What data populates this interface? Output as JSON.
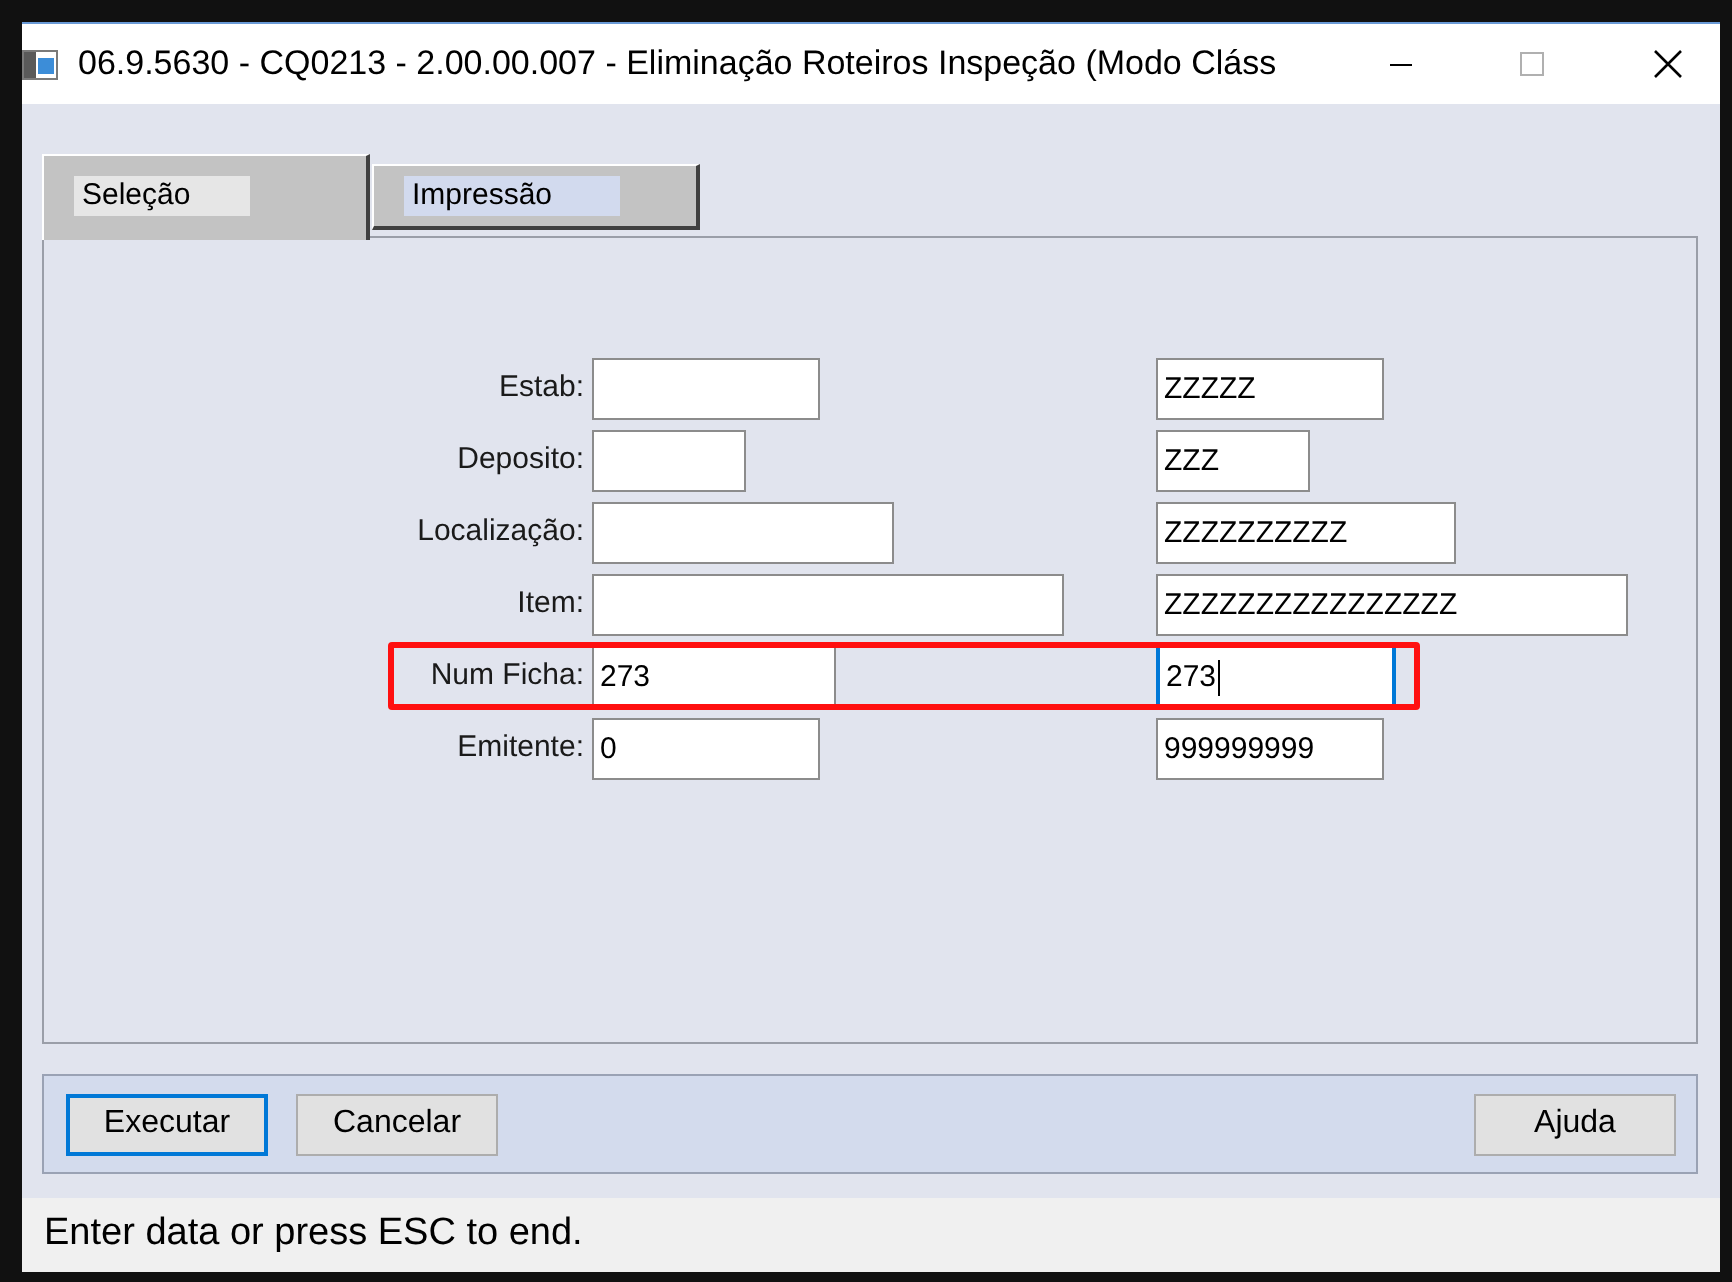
{
  "window": {
    "title": "06.9.5630 - CQ0213 - 2.00.00.007 - Eliminação Roteiros Inspeção (Modo Cláss"
  },
  "tabs": [
    {
      "label": "Seleção",
      "selected": true
    },
    {
      "label": "Impressão",
      "selected": false
    }
  ],
  "rows": [
    {
      "label": "Estab:",
      "highlighted": false,
      "fields": [
        {
          "focused": false
        },
        {
          "value": "ZZZZZ",
          "focused": false
        }
      ]
    },
    {
      "label": "Deposito:",
      "highlighted": false,
      "fields": [
        {
          "focused": false
        },
        {
          "value": "ZZZ",
          "focused": false
        }
      ]
    },
    {
      "label": "Localização:",
      "highlighted": false,
      "fields": [
        {
          "focused": false
        },
        {
          "value": "ZZZZZZZZZZ",
          "focused": false
        }
      ]
    },
    {
      "label": "Item:",
      "highlighted": false,
      "fields": [
        {
          "focused": false
        },
        {
          "value": "ZZZZZZZZZZZZZZZZ",
          "focused": false
        }
      ]
    },
    {
      "label": "Num Ficha:",
      "highlighted": true,
      "fields": [
        {
          "value": "273",
          "focused": false
        },
        {
          "value": "273",
          "focused": true
        }
      ]
    },
    {
      "label": "Emitente:",
      "highlighted": false,
      "fields": [
        {
          "value": "0",
          "focused": false
        },
        {
          "value": "999999999",
          "focused": false
        }
      ]
    }
  ],
  "button_bar": {
    "left_buttons": [
      {
        "label": "Executar",
        "focused": true
      },
      {
        "label": "Cancelar",
        "focused": false
      }
    ],
    "right_buttons": [
      {
        "label": "Ajuda",
        "focused": false
      }
    ]
  },
  "status_bar": {
    "text": "Enter data or press ESC to end."
  }
}
